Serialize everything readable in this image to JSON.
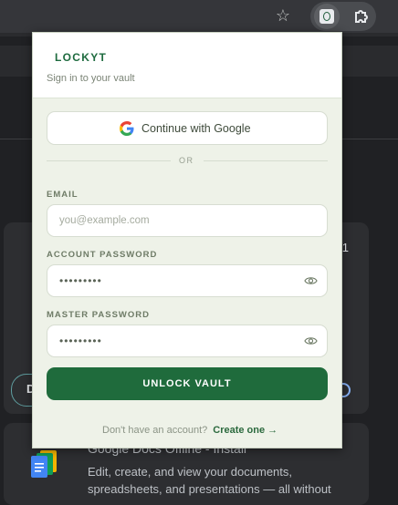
{
  "browser": {
    "icons": [
      "star-icon",
      "lockyt-extension-icon",
      "puzzle-icon"
    ]
  },
  "background_page": {
    "badge_number": "1",
    "pill_text": "D",
    "card_title": "Google Docs Offline - Install",
    "card_description": "Edit, create, and view your documents, spreadsheets, and presentations — all without"
  },
  "popup": {
    "logo": "LOCKYT",
    "subtitle": "Sign in to your vault",
    "google_button": "Continue with Google",
    "divider": "OR",
    "email": {
      "label": "EMAIL",
      "placeholder": "you@example.com",
      "value": ""
    },
    "account_password": {
      "label": "ACCOUNT PASSWORD",
      "masked_value": "•••••••••"
    },
    "master_password": {
      "label": "MASTER PASSWORD",
      "masked_value": "•••••••••"
    },
    "unlock_button": "UNLOCK VAULT",
    "footer": {
      "question": "Don't have an account?",
      "link": "Create one →"
    }
  },
  "colors": {
    "brand_green": "#1f6b3c",
    "popup_bg": "#eef2e8",
    "browser_bg": "#202124"
  }
}
